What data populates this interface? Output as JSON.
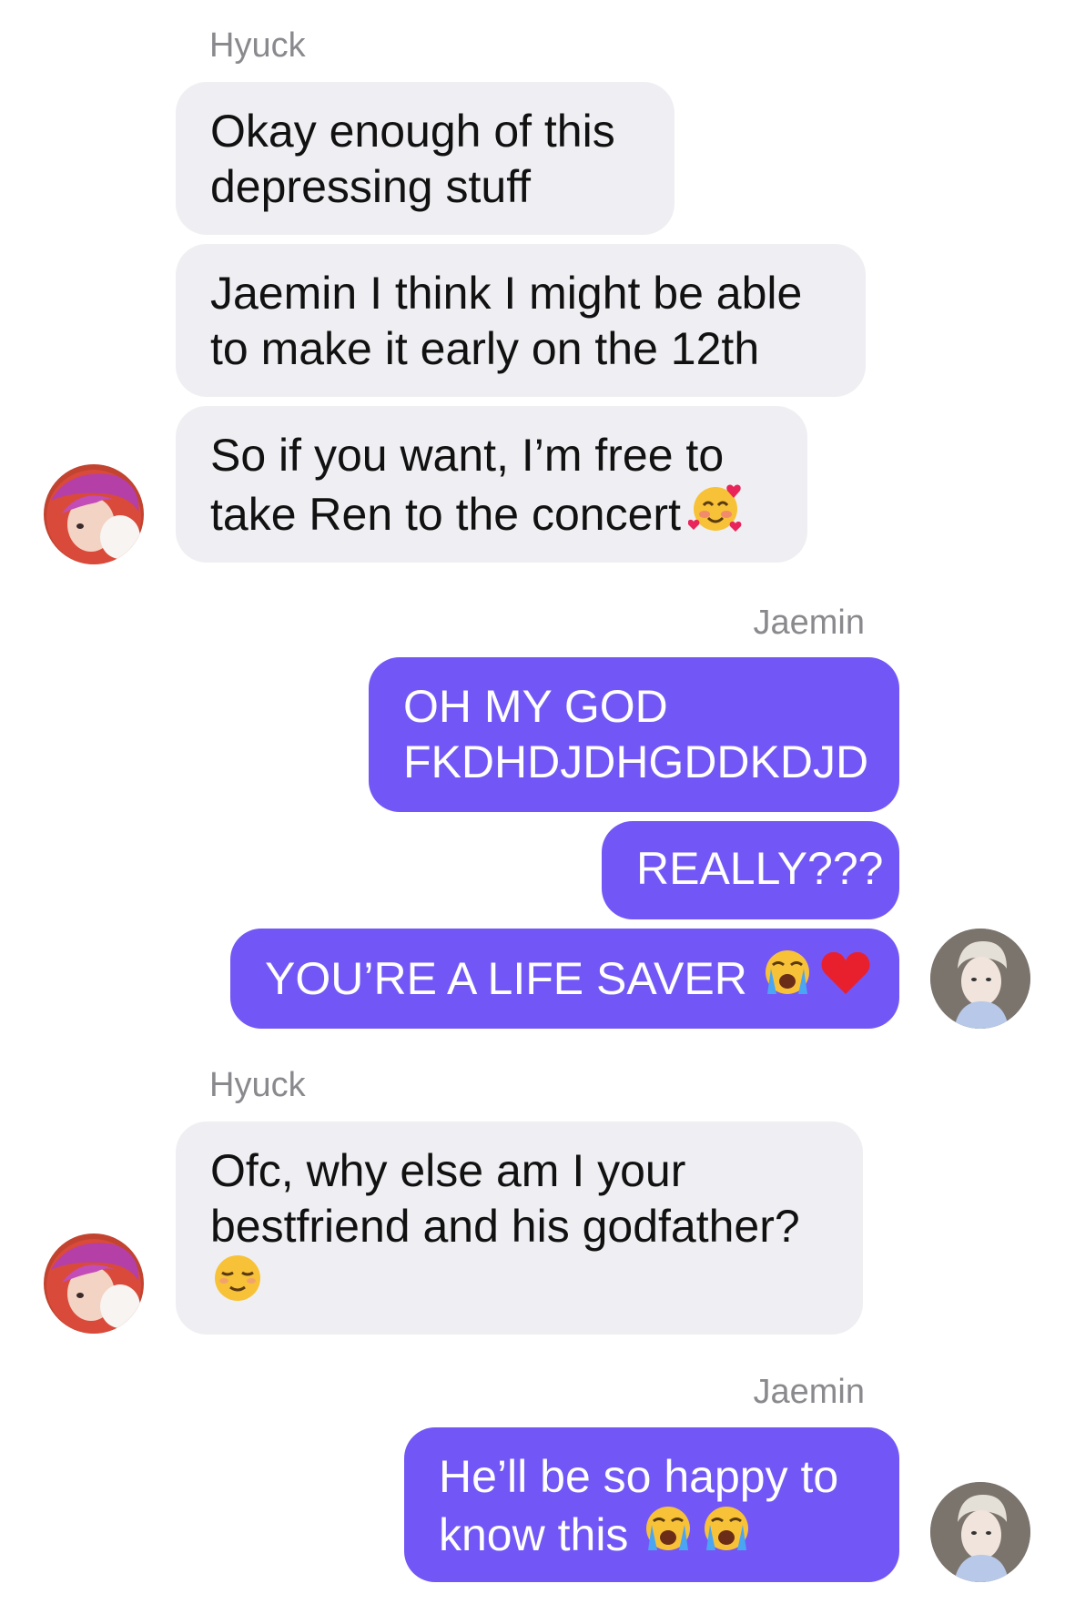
{
  "messages": [
    {
      "sender": "Hyuck",
      "lines": [
        "Okay enough of this",
        "depressing stuff"
      ]
    },
    {
      "lines": [
        "Jaemin I think I might be able",
        "to make it early on the 12th"
      ]
    },
    {
      "lines": [
        "So if you want, I’m free to",
        "take Ren to the concert"
      ],
      "emoji": "smiling-face-with-hearts-icon"
    },
    {
      "sender": "Jaemin",
      "lines": [
        "OH MY GOD",
        "FKDHDJDHGDDKDJD"
      ]
    },
    {
      "lines": [
        "REALLY???"
      ]
    },
    {
      "lines": [
        "YOU’RE A LIFE SAVER"
      ],
      "emoji": [
        "loudly-crying-face-icon",
        "red-heart-icon"
      ]
    },
    {
      "sender": "Hyuck",
      "lines": [
        "Ofc, why else am I your",
        "bestfriend and his godfather?"
      ],
      "emoji": "relieved-face-icon"
    },
    {
      "sender": "Jaemin",
      "lines": [
        "He’ll be so happy to",
        "know this"
      ],
      "emoji": [
        "loudly-crying-face-icon",
        "loudly-crying-face-icon"
      ]
    }
  ],
  "colors": {
    "incoming_bubble": "#efeff3",
    "outgoing_bubble": "#7357f6",
    "sender_label": "#8a8a8e"
  }
}
